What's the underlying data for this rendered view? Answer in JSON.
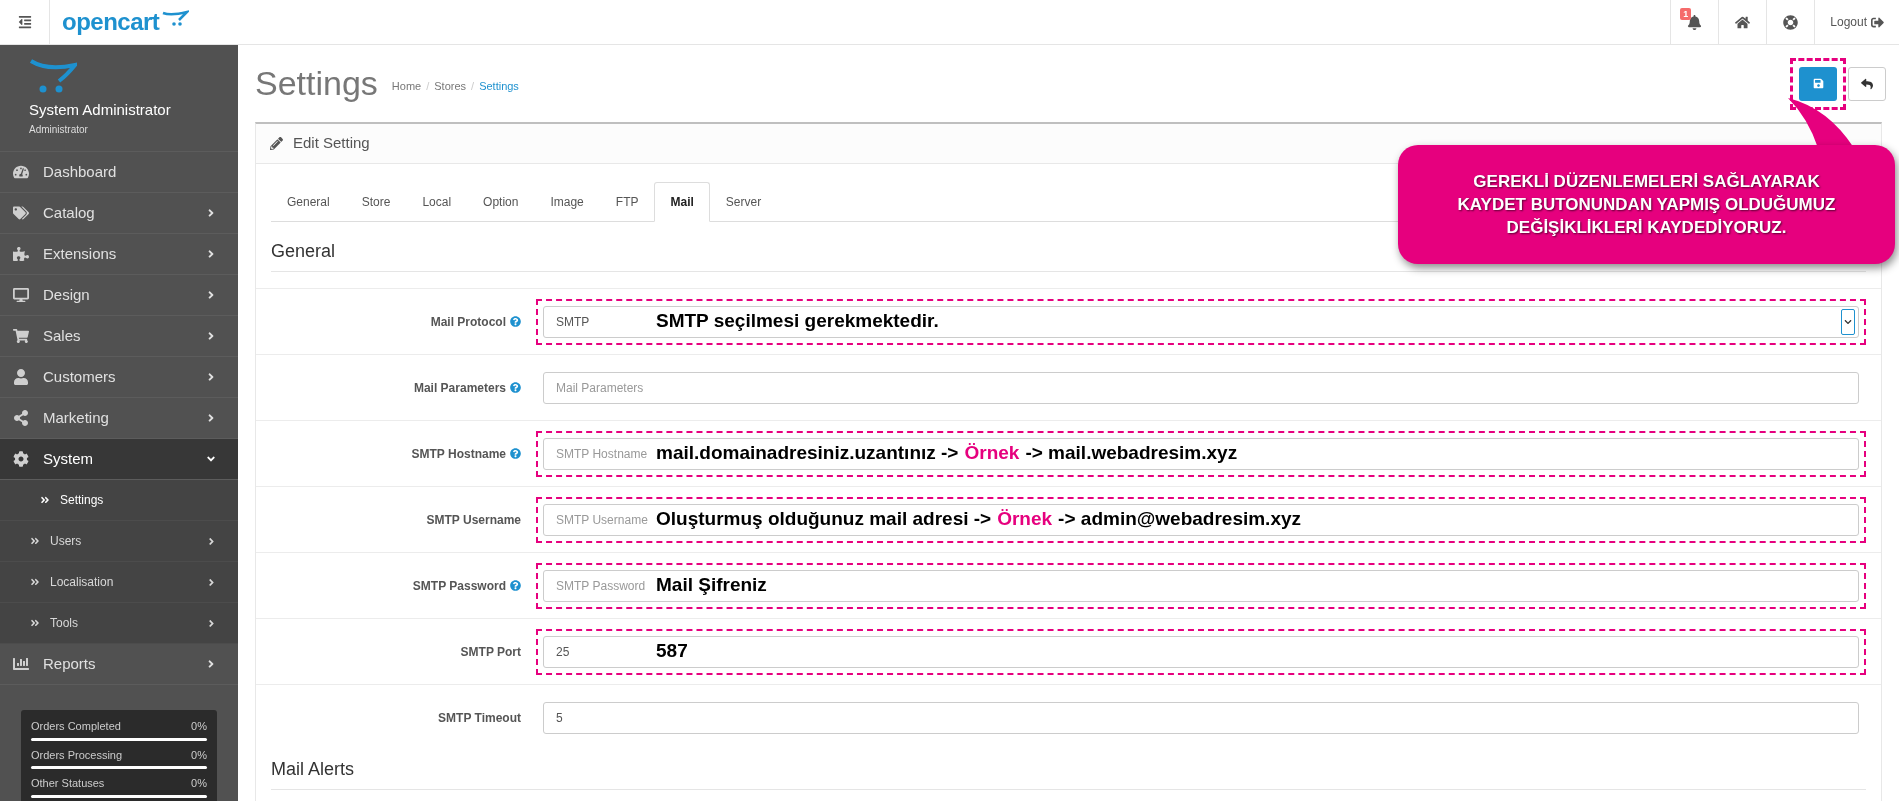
{
  "topbar": {
    "brand": "opencart",
    "notification_count": "1",
    "logout": "Logout"
  },
  "sidebar": {
    "user_name": "System Administrator",
    "user_role": "Administrator",
    "items": [
      {
        "label": "Dashboard",
        "kind": "link",
        "selected": false
      },
      {
        "label": "Catalog",
        "kind": "menu",
        "expanded": false,
        "selected": false
      },
      {
        "label": "Extensions",
        "kind": "menu",
        "expanded": false,
        "selected": false
      },
      {
        "label": "Design",
        "kind": "menu",
        "expanded": false,
        "selected": false
      },
      {
        "label": "Sales",
        "kind": "menu",
        "expanded": false,
        "selected": false
      },
      {
        "label": "Customers",
        "kind": "menu",
        "expanded": false,
        "selected": false
      },
      {
        "label": "Marketing",
        "kind": "menu",
        "expanded": false,
        "selected": false
      },
      {
        "label": "System",
        "kind": "menu",
        "expanded": true,
        "selected": true,
        "children": [
          {
            "label": "Settings",
            "kind": "link",
            "selected": true
          },
          {
            "label": "Users",
            "kind": "menu",
            "selected": false
          },
          {
            "label": "Localisation",
            "kind": "menu",
            "selected": false
          },
          {
            "label": "Tools",
            "kind": "menu",
            "selected": false
          }
        ]
      },
      {
        "label": "Reports",
        "kind": "menu",
        "expanded": false,
        "selected": false
      }
    ],
    "stats": [
      {
        "label": "Orders Completed",
        "reading": "0%",
        "level": 0
      },
      {
        "label": "Orders Processing",
        "reading": "0%",
        "level": 0
      },
      {
        "label": "Other Statuses",
        "reading": "0%",
        "level": 0
      }
    ]
  },
  "page": {
    "title": "Settings",
    "breadcrumb_separator": "/",
    "breadcrumb": [
      {
        "label": "Home",
        "selected": false
      },
      {
        "label": "Stores",
        "selected": false
      },
      {
        "label": "Settings",
        "selected": true
      }
    ],
    "save_highlighted": true
  },
  "panel": {
    "title": "Edit Setting",
    "tabs": [
      {
        "label": "General",
        "selected": false
      },
      {
        "label": "Store",
        "selected": false
      },
      {
        "label": "Local",
        "selected": false
      },
      {
        "label": "Option",
        "selected": false
      },
      {
        "label": "Image",
        "selected": false
      },
      {
        "label": "FTP",
        "selected": false
      },
      {
        "label": "Mail",
        "selected": true
      },
      {
        "label": "Server",
        "selected": false
      }
    ],
    "section": "General",
    "fields": [
      {
        "label": "Mail Protocol",
        "help": true,
        "kind": "select",
        "value": "SMTP",
        "highlighted": true,
        "note": [
          {
            "text": "SMTP seçilmesi gerekmektedir.",
            "accent": false
          }
        ]
      },
      {
        "label": "Mail Parameters",
        "help": true,
        "kind": "input",
        "placeholder": "Mail Parameters",
        "highlighted": false
      },
      {
        "label": "SMTP Hostname",
        "help": true,
        "kind": "input",
        "placeholder": "SMTP Hostname",
        "highlighted": true,
        "note": [
          {
            "text": "mail.domainadresiniz.uzantınız ->",
            "accent": false
          },
          {
            "text": "Örnek",
            "accent": true
          },
          {
            "text": "-> mail.webadresim.xyz",
            "accent": false
          }
        ]
      },
      {
        "label": "SMTP Username",
        "help": false,
        "kind": "input",
        "placeholder": "SMTP Username",
        "highlighted": true,
        "note": [
          {
            "text": "Oluşturmuş olduğunuz mail adresi ->",
            "accent": false
          },
          {
            "text": "Örnek",
            "accent": true
          },
          {
            "text": "-> admin@webadresim.xyz",
            "accent": false
          }
        ]
      },
      {
        "label": "SMTP Password",
        "help": true,
        "kind": "input",
        "placeholder": "SMTP Password",
        "highlighted": true,
        "note": [
          {
            "text": "Mail Şifreniz",
            "accent": false
          }
        ]
      },
      {
        "label": "SMTP Port",
        "help": false,
        "kind": "input",
        "value": "25",
        "highlighted": true,
        "note": [
          {
            "text": "587",
            "accent": false
          }
        ]
      },
      {
        "label": "SMTP Timeout",
        "help": false,
        "kind": "input",
        "value": "5",
        "highlighted": false
      }
    ],
    "next_section": "Mail Alerts"
  },
  "callout": {
    "lines": [
      "GEREKLİ DÜZENLEMELERİ SAĞLAYARAK",
      "KAYDET BUTONUNDAN YAPMIŞ OLDUĞUMUZ",
      "DEĞİŞİKLİKLERİ KAYDEDİYORUZ."
    ]
  }
}
